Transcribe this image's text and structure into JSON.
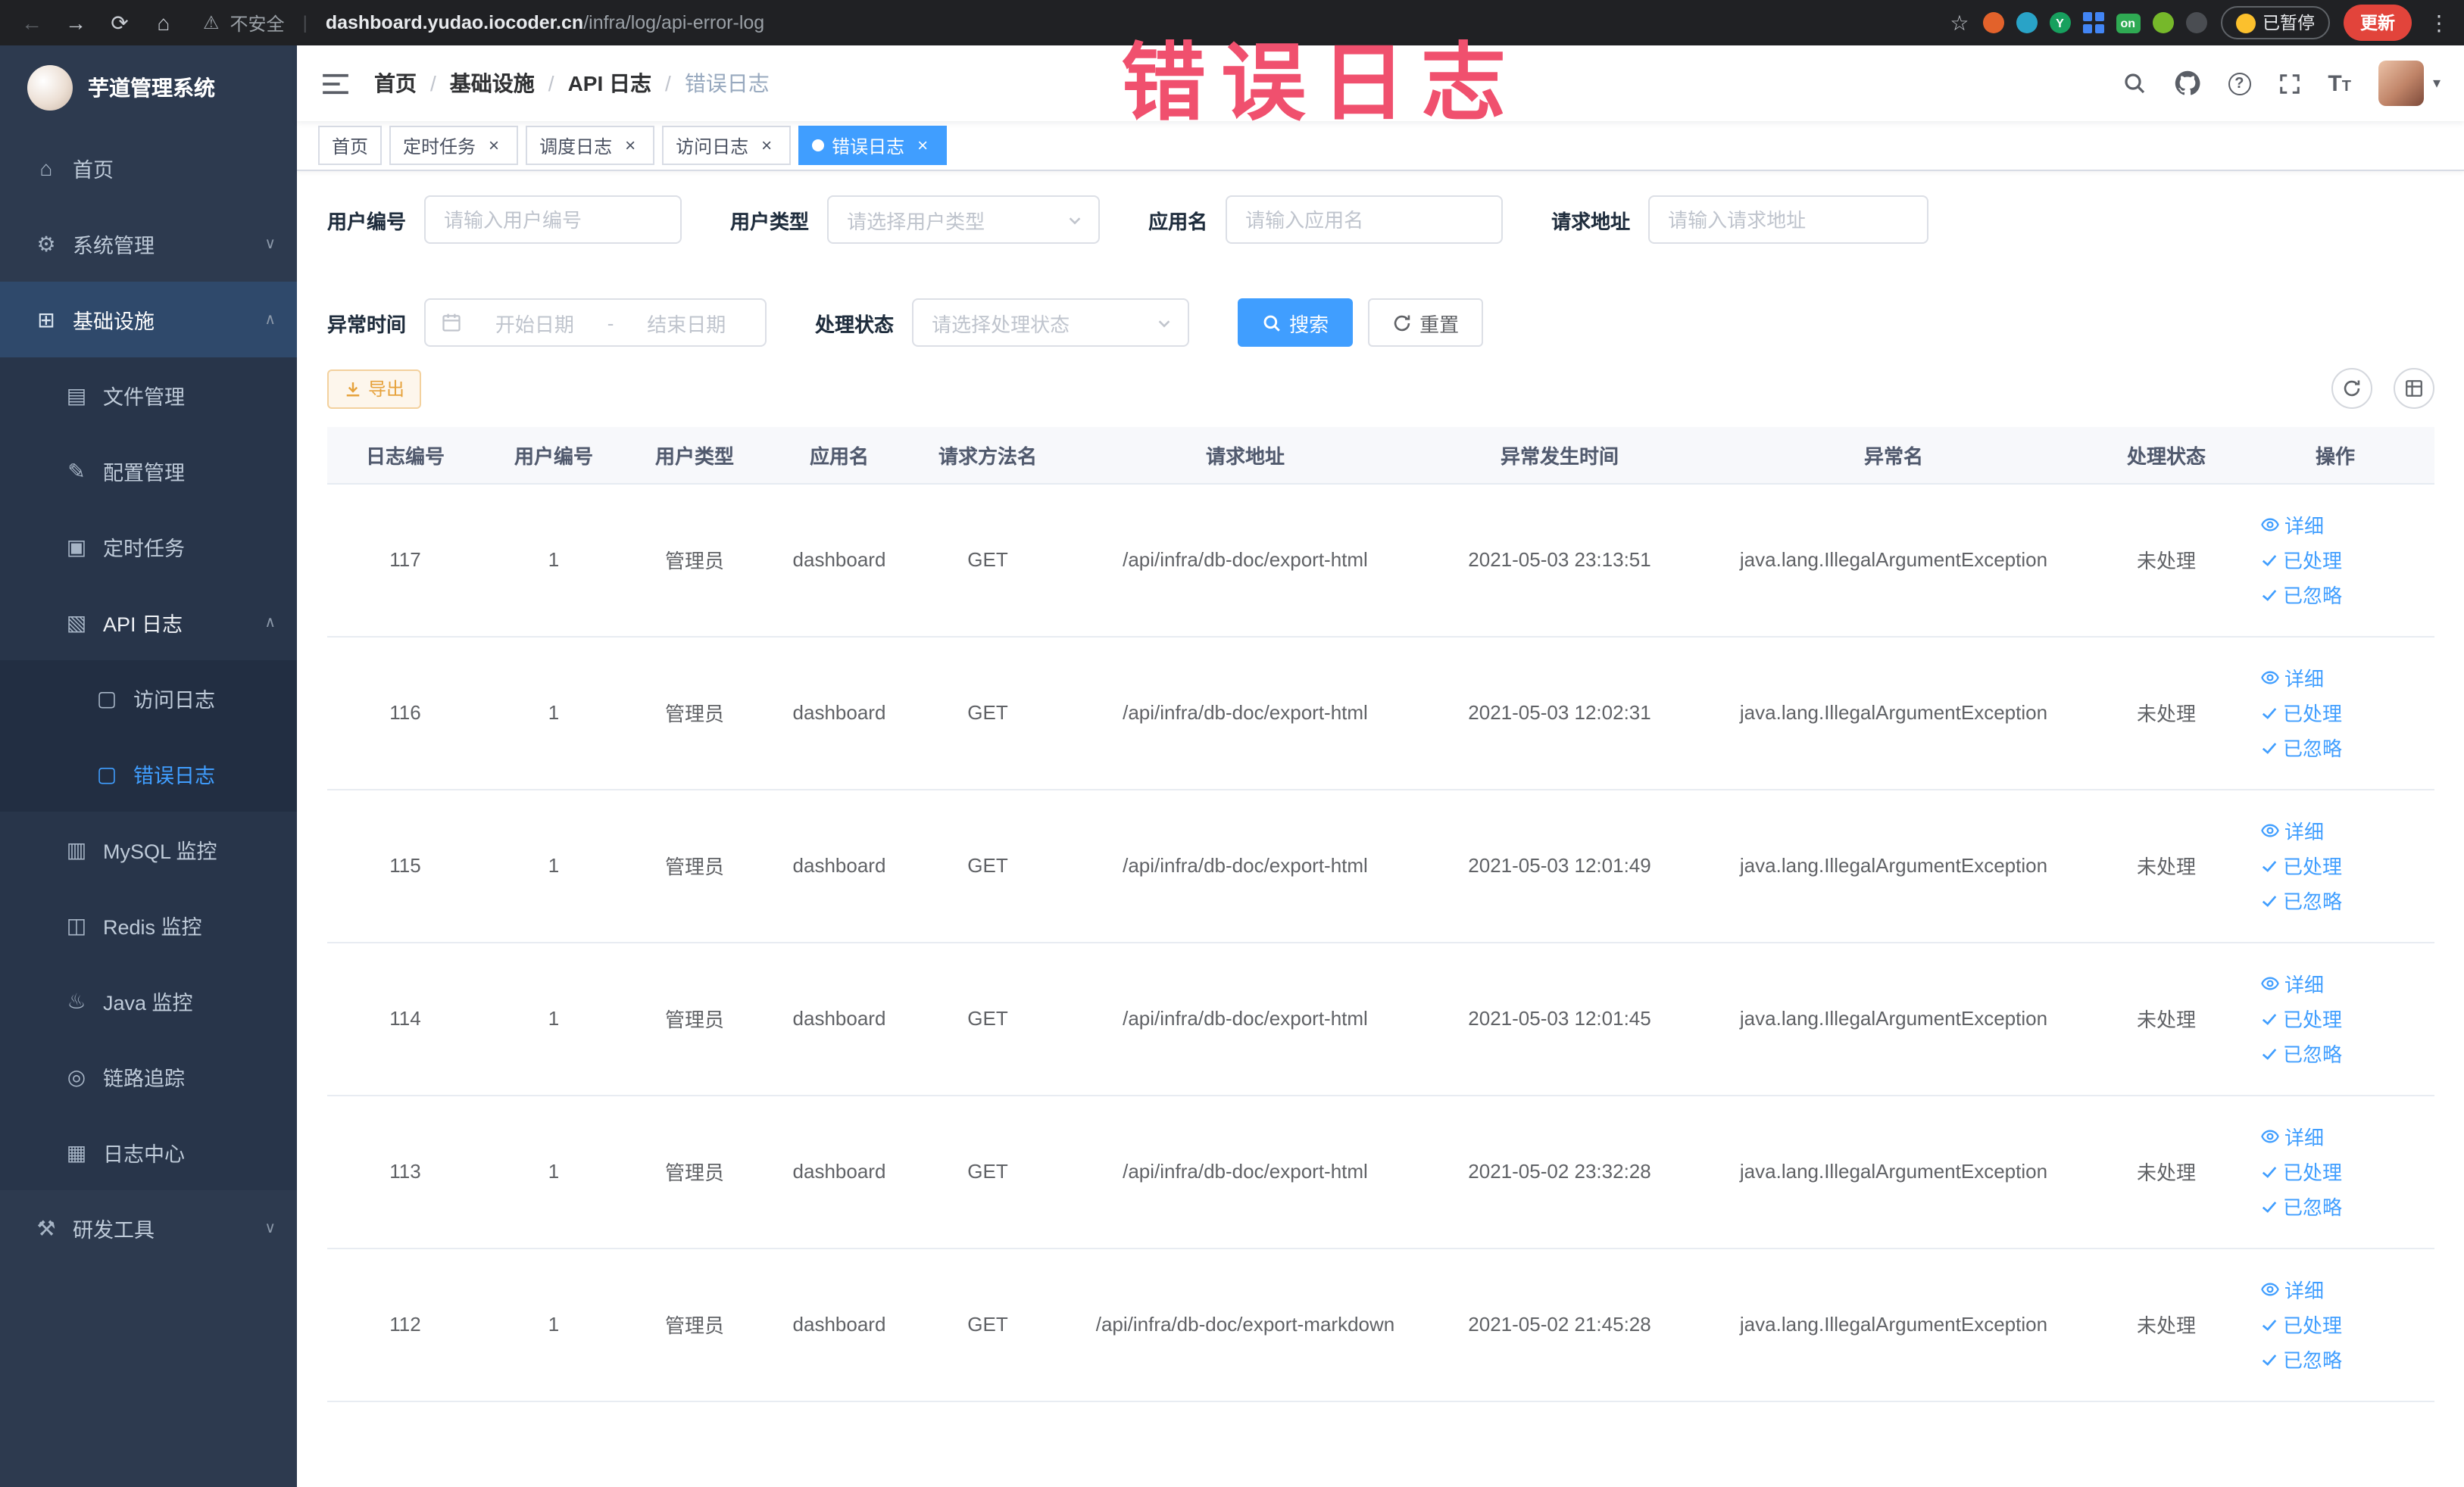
{
  "colors": {
    "accent": "#409eff",
    "annotation": "#f0506e",
    "warning": "#e6a23c",
    "chrome-bg": "#202124",
    "sidebar-bg": "#2d3a4f",
    "update-bg": "#e2443b"
  },
  "annotation": {
    "text": "错误日志"
  },
  "browser": {
    "security_label": "不安全",
    "url_domain": "dashboard.yudao.iocoder.cn",
    "url_path": "/infra/log/api-error-log",
    "paused_badge": "已暂停",
    "update_button": "更新",
    "extensions": [
      {
        "name": "extension-icon-orange",
        "type": "dot",
        "color": "#e2622b",
        "text": ""
      },
      {
        "name": "extension-icon-teal",
        "type": "dot",
        "color": "#29a3c7",
        "text": ""
      },
      {
        "name": "extension-icon-green-y",
        "type": "dot",
        "color": "#17a05e",
        "text": "Y"
      },
      {
        "name": "extension-icon-grid",
        "type": "grid",
        "color": "#4285f4",
        "text": ""
      },
      {
        "name": "extension-icon-on-badge",
        "type": "badge",
        "color": "#2faa53",
        "text": "on"
      },
      {
        "name": "extension-icon-leaf",
        "type": "dot",
        "color": "#76b82a",
        "text": ""
      },
      {
        "name": "extension-icon-dark",
        "type": "dot",
        "color": "#4a4d52",
        "text": ""
      }
    ]
  },
  "sidebar": {
    "logo_title": "芋道管理系统",
    "items": [
      {
        "name": "home",
        "label": "首页",
        "icon": "home-icon",
        "level": 1
      },
      {
        "name": "system-management",
        "label": "系统管理",
        "icon": "gear-icon",
        "level": 1,
        "chevron": "down"
      },
      {
        "name": "infrastructure",
        "label": "基础设施",
        "icon": "infra-icon",
        "level": 1,
        "chevron": "up",
        "highlight": true
      },
      {
        "name": "file-management",
        "label": "文件管理",
        "icon": "file-icon",
        "level": 2
      },
      {
        "name": "config-management",
        "label": "配置管理",
        "icon": "config-icon",
        "level": 2
      },
      {
        "name": "scheduled-tasks",
        "label": "定时任务",
        "icon": "task-icon",
        "level": 2
      },
      {
        "name": "api-logs",
        "label": "API 日志",
        "icon": "api-log-icon",
        "level": 2,
        "chevron": "up",
        "trail": true
      },
      {
        "name": "access-logs",
        "label": "访问日志",
        "icon": "doc-icon",
        "level": 3
      },
      {
        "name": "error-logs",
        "label": "错误日志",
        "icon": "doc-icon",
        "level": 3,
        "active": true
      },
      {
        "name": "mysql-monitor",
        "label": "MySQL 监控",
        "icon": "mysql-icon",
        "level": 2
      },
      {
        "name": "redis-monitor",
        "label": "Redis 监控",
        "icon": "redis-icon",
        "level": 2
      },
      {
        "name": "java-monitor",
        "label": "Java 监控",
        "icon": "java-icon",
        "level": 2
      },
      {
        "name": "link-tracing",
        "label": "链路追踪",
        "icon": "trace-icon",
        "level": 2
      },
      {
        "name": "log-center",
        "label": "日志中心",
        "icon": "log-center-icon",
        "level": 2
      },
      {
        "name": "dev-tools",
        "label": "研发工具",
        "icon": "tools-icon",
        "level": 1,
        "chevron": "down"
      }
    ]
  },
  "header": {
    "breadcrumb": [
      "首页",
      "基础设施",
      "API 日志",
      "错误日志"
    ]
  },
  "tabs": [
    {
      "label": "首页",
      "closable": false,
      "active": false
    },
    {
      "label": "定时任务",
      "closable": true,
      "active": false
    },
    {
      "label": "调度日志",
      "closable": true,
      "active": false
    },
    {
      "label": "访问日志",
      "closable": true,
      "active": false
    },
    {
      "label": "错误日志",
      "closable": true,
      "active": true
    }
  ],
  "filters": {
    "user_id": {
      "label": "用户编号",
      "placeholder": "请输入用户编号"
    },
    "user_type": {
      "label": "用户类型",
      "placeholder": "请选择用户类型"
    },
    "app_name": {
      "label": "应用名",
      "placeholder": "请输入应用名"
    },
    "request_url": {
      "label": "请求地址",
      "placeholder": "请输入请求地址"
    },
    "exception_time": {
      "label": "异常时间",
      "start_placeholder": "开始日期",
      "separator": "-",
      "end_placeholder": "结束日期"
    },
    "process_status": {
      "label": "处理状态",
      "placeholder": "请选择处理状态"
    },
    "search_button": "搜索",
    "reset_button": "重置"
  },
  "toolbar": {
    "export_button": "导出"
  },
  "table": {
    "columns": [
      "日志编号",
      "用户编号",
      "用户类型",
      "应用名",
      "请求方法名",
      "请求地址",
      "异常发生时间",
      "异常名",
      "处理状态",
      "操作"
    ],
    "row_actions": [
      {
        "name": "detail",
        "label": "详细",
        "icon": "eye-icon"
      },
      {
        "name": "processed",
        "label": "已处理",
        "icon": "check-icon"
      },
      {
        "name": "ignored",
        "label": "已忽略",
        "icon": "check-icon"
      }
    ],
    "rows": [
      {
        "cells": [
          "117",
          "1",
          "管理员",
          "dashboard",
          "GET",
          "/api/infra/db-doc/export-html",
          "2021-05-03 23:13:51",
          "java.lang.IllegalArgumentException",
          "未处理"
        ]
      },
      {
        "cells": [
          "116",
          "1",
          "管理员",
          "dashboard",
          "GET",
          "/api/infra/db-doc/export-html",
          "2021-05-03 12:02:31",
          "java.lang.IllegalArgumentException",
          "未处理"
        ]
      },
      {
        "cells": [
          "115",
          "1",
          "管理员",
          "dashboard",
          "GET",
          "/api/infra/db-doc/export-html",
          "2021-05-03 12:01:49",
          "java.lang.IllegalArgumentException",
          "未处理"
        ]
      },
      {
        "cells": [
          "114",
          "1",
          "管理员",
          "dashboard",
          "GET",
          "/api/infra/db-doc/export-html",
          "2021-05-03 12:01:45",
          "java.lang.IllegalArgumentException",
          "未处理"
        ]
      },
      {
        "cells": [
          "113",
          "1",
          "管理员",
          "dashboard",
          "GET",
          "/api/infra/db-doc/export-html",
          "2021-05-02 23:32:28",
          "java.lang.IllegalArgumentException",
          "未处理"
        ]
      },
      {
        "cells": [
          "112",
          "1",
          "管理员",
          "dashboard",
          "GET",
          "/api/infra/db-doc/export-markdown",
          "2021-05-02 21:45:28",
          "java.lang.IllegalArgumentException",
          "未处理"
        ]
      }
    ]
  }
}
